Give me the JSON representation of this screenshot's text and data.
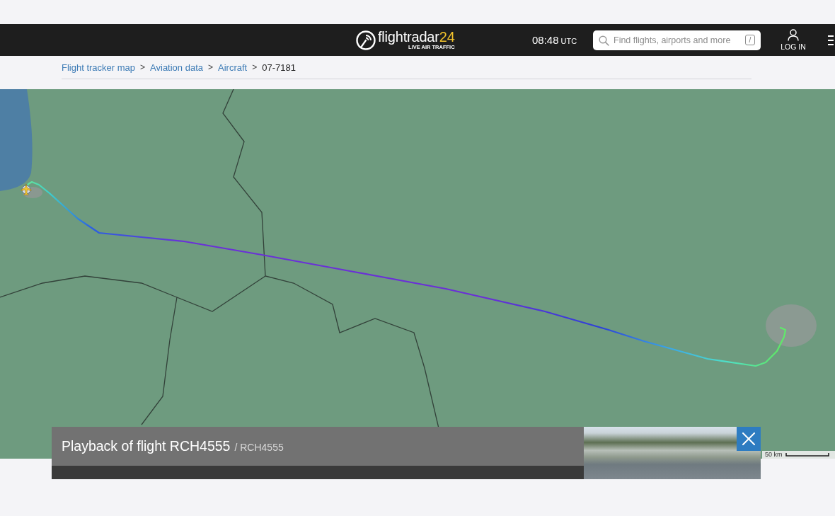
{
  "header": {
    "logo": {
      "name": "flightradar",
      "accent": "24",
      "tagline": "LIVE AIR TRAFFIC"
    },
    "clock": {
      "time": "08:48",
      "zone": "UTC"
    },
    "search": {
      "placeholder": "Find flights, airports and more",
      "shortcut": "/"
    },
    "login": "LOG IN"
  },
  "breadcrumb": [
    {
      "label": "Flight tracker map",
      "kind": "link"
    },
    {
      "separator": ">",
      "label": "Aviation data",
      "kind": "link"
    },
    {
      "separator": ">",
      "label": "Aircraft",
      "kind": "link"
    },
    {
      "separator": ">",
      "label": "07-7181",
      "kind": "current"
    }
  ],
  "map": {
    "scale": "50 km"
  },
  "playback": {
    "title": "Playback of flight RCH4555",
    "callsign": "/ RCH4555"
  }
}
